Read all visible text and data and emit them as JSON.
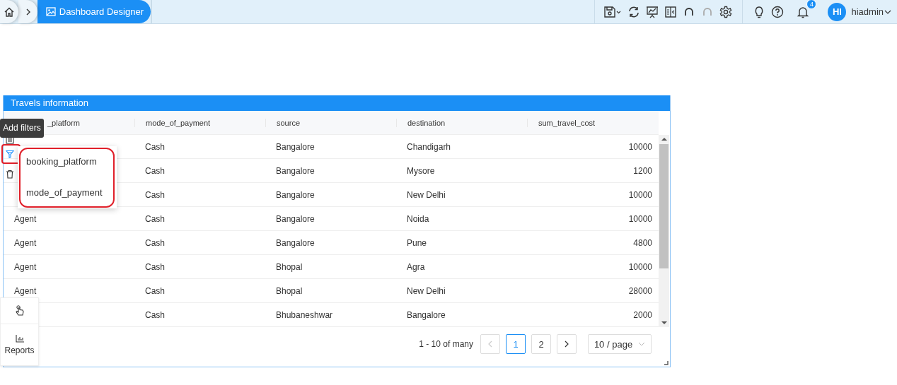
{
  "breadcrumb": {
    "current": "Dashboard Designer"
  },
  "toolbar": {
    "tools": [
      {
        "kind": "save",
        "disabled": false
      },
      {
        "kind": "refresh",
        "disabled": false
      },
      {
        "kind": "present",
        "disabled": false
      },
      {
        "kind": "panel",
        "disabled": false
      },
      {
        "kind": "undo",
        "disabled": false
      },
      {
        "kind": "redo",
        "disabled": true
      },
      {
        "kind": "settings",
        "disabled": false
      }
    ],
    "notification_count": "4",
    "avatar": "HI",
    "user": "hiadmin"
  },
  "table": {
    "title": "Travels information",
    "columns": [
      "_platform",
      "mode_of_payment",
      "source",
      "destination",
      "sum_travel_cost"
    ],
    "rows": [
      [
        null,
        "Cash",
        "Bangalore",
        "Chandigarh",
        "10000"
      ],
      [
        null,
        "Cash",
        "Bangalore",
        "Mysore",
        "1200"
      ],
      [
        null,
        "Cash",
        "Bangalore",
        "New Delhi",
        "10000"
      ],
      [
        "Agent",
        "Cash",
        "Bangalore",
        "Noida",
        "10000"
      ],
      [
        "Agent",
        "Cash",
        "Bangalore",
        "Pune",
        "4800"
      ],
      [
        "Agent",
        "Cash",
        "Bhopal",
        "Agra",
        "10000"
      ],
      [
        "Agent",
        "Cash",
        "Bhopal",
        "New Delhi",
        "28000"
      ],
      [
        null,
        "Cash",
        "Bhubaneshwar",
        "Bangalore",
        "2000"
      ]
    ],
    "pagination": {
      "summary": "1 - 10 of many",
      "prev_disabled": true,
      "pages": [
        {
          "label": "1",
          "selected": true
        },
        {
          "label": "2",
          "selected": false
        }
      ],
      "page_size": "10 / page"
    }
  },
  "tooltip": "Add filters",
  "filter_menu": [
    "booking_platform",
    "mode_of_payment"
  ],
  "side_panel": {
    "label": "Reports"
  }
}
